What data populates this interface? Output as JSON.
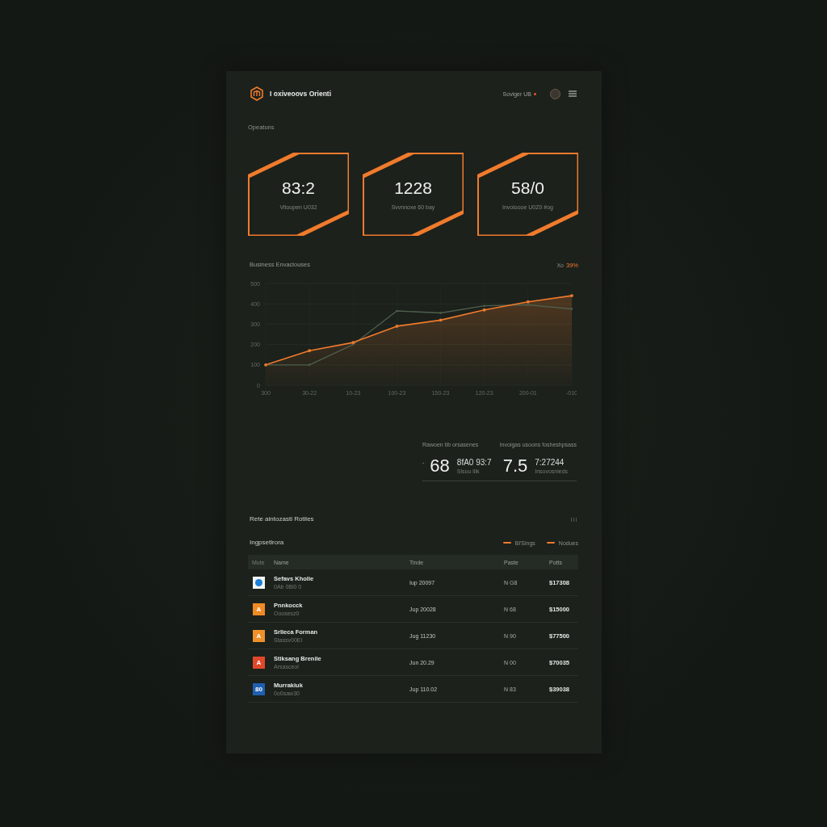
{
  "header": {
    "title": "I oxiveoovs Orienti",
    "account": "Soviger UB",
    "notification": true
  },
  "section_label": "Opeatuns",
  "stats": [
    {
      "value": "83:2",
      "label": "Vitoupen U032"
    },
    {
      "value": "1228",
      "label": "Svvnnoxe 60 bay"
    },
    {
      "value": "58/0",
      "label": "Invoioooe U0Z0 #og"
    }
  ],
  "chart": {
    "change_label": "Xo",
    "change_value": "39%",
    "chart_data": {
      "type": "line",
      "title": "Business Envaclouses",
      "grid": true,
      "categories": [
        "300",
        "30-22",
        "10-23",
        "100-23",
        "150-23",
        "120-23",
        "200-01",
        "-010"
      ],
      "ylim": [
        0,
        500
      ],
      "yticks": [
        0,
        100,
        200,
        300,
        400,
        500
      ],
      "series": [
        {
          "type": "area",
          "color": "#f07b2c",
          "values": [
            100,
            170,
            210,
            290,
            320,
            370,
            410,
            440
          ]
        },
        {
          "color": "#4f5f4b",
          "values": [
            100,
            100,
            200,
            365,
            355,
            390,
            395,
            375
          ]
        }
      ]
    }
  },
  "summary": [
    {
      "label": "Rawoen tib orsasenes",
      "prefix": "-",
      "value": "68",
      "detail": "8fA0 93:7",
      "sub": "Sisuu llik"
    },
    {
      "label": "Invoigas usoons fosheshpsass",
      "value": "7.5",
      "detail": "7:27244",
      "sub": "Insovosnieds"
    }
  ],
  "table": {
    "title": "Rete aintozasti Rotiles",
    "subtitle": "Ingpsetlrora",
    "legend": [
      "Bl'Sings",
      "Nodues"
    ],
    "columns": [
      "Mute",
      "Name",
      "Tinde",
      "Paste",
      "Potts"
    ],
    "rows": [
      {
        "logo": {
          "kind": "dot",
          "color": "#1e7fd8"
        },
        "name": "Sefavs Kholie",
        "sub": "0Ab 0Bl0 0",
        "date": "Iup 20097",
        "qty": "N G8",
        "price": "$17308"
      },
      {
        "logo": {
          "kind": "letter",
          "text": "A",
          "color": "#f08a24"
        },
        "name": "Pnnkocck",
        "sub": "Ooosesz0",
        "date": "Jup 20028",
        "qty": "N 68",
        "price": "$15000"
      },
      {
        "logo": {
          "kind": "letter",
          "text": "A",
          "color": "#f0902a"
        },
        "name": "Srlieca Forman",
        "sub": "Stassv00El",
        "date": "Jug 11230",
        "qty": "N 90",
        "price": "$77500"
      },
      {
        "logo": {
          "kind": "letter",
          "text": "A",
          "color": "#e0482a"
        },
        "name": "Stiksang Brenile",
        "sub": "Arsasceol",
        "date": "Jun 20.29",
        "qty": "N 00",
        "price": "$70035"
      },
      {
        "logo": {
          "kind": "letter",
          "text": "80",
          "color": "#1f5fb0"
        },
        "name": "Murrakiuk",
        "sub": "0o0saw30",
        "date": "Jup 110.02",
        "qty": "N 83",
        "price": "$39038"
      }
    ]
  }
}
